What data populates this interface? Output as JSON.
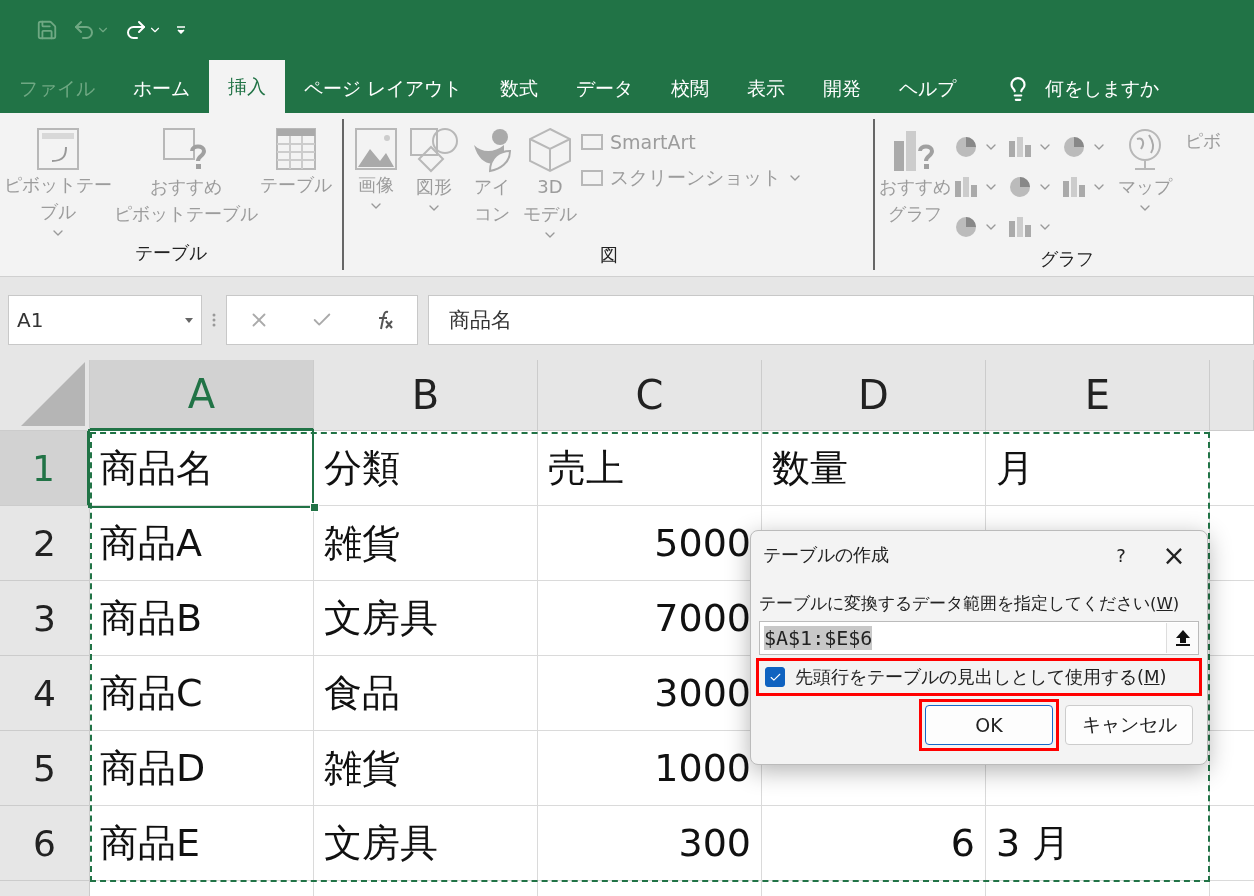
{
  "tabs": [
    {
      "label": "ファイル",
      "selected": false,
      "disabled": true
    },
    {
      "label": "ホーム",
      "selected": false,
      "disabled": false
    },
    {
      "label": "挿入",
      "selected": true,
      "disabled": false
    },
    {
      "label": "ページ レイアウト",
      "selected": false,
      "disabled": false
    },
    {
      "label": "数式",
      "selected": false,
      "disabled": false
    },
    {
      "label": "データ",
      "selected": false,
      "disabled": false
    },
    {
      "label": "校閲",
      "selected": false,
      "disabled": false
    },
    {
      "label": "表示",
      "selected": false,
      "disabled": false
    },
    {
      "label": "開発",
      "selected": false,
      "disabled": false
    },
    {
      "label": "ヘルプ",
      "selected": false,
      "disabled": false
    }
  ],
  "tell_me": "何をしますか",
  "ribbon": {
    "groups": [
      {
        "label": "テーブル",
        "items": [
          {
            "kind": "large",
            "lines": [
              "ピボットテー",
              "ブル"
            ],
            "dropdown": true
          },
          {
            "kind": "large",
            "lines": [
              "おすすめ",
              "ピボットテーブル"
            ],
            "dropdown": false
          },
          {
            "kind": "large",
            "lines": [
              "テーブル"
            ],
            "dropdown": false
          }
        ]
      },
      {
        "label": "図",
        "items": [
          {
            "kind": "large",
            "lines": [
              "画像"
            ],
            "dropdown": true
          },
          {
            "kind": "large",
            "lines": [
              "図形"
            ],
            "dropdown": true
          },
          {
            "kind": "large",
            "lines": [
              "アイ",
              "コン"
            ],
            "dropdown": false
          },
          {
            "kind": "large",
            "lines": [
              "3D",
              "モデル"
            ],
            "dropdown": true
          },
          {
            "kind": "small",
            "lines": [
              "SmartArt"
            ],
            "dropdown": false
          },
          {
            "kind": "small",
            "lines": [
              "スクリーンショット"
            ],
            "dropdown": true
          }
        ]
      },
      {
        "label": "グラフ",
        "items": [
          {
            "kind": "large",
            "lines": [
              "おすすめ",
              "グラフ"
            ],
            "dropdown": false
          },
          {
            "kind": "gallery",
            "dropdown": true
          },
          {
            "kind": "large",
            "lines": [
              "マップ"
            ],
            "dropdown": true
          },
          {
            "kind": "large",
            "lines": [
              "ピボ"
            ],
            "dropdown": false
          }
        ]
      }
    ]
  },
  "formula_bar": {
    "name_box": "A1",
    "formula": "商品名"
  },
  "grid": {
    "columns": [
      {
        "label": "A",
        "selected": true
      },
      {
        "label": "B",
        "selected": false
      },
      {
        "label": "C",
        "selected": false
      },
      {
        "label": "D",
        "selected": false
      },
      {
        "label": "E",
        "selected": false
      }
    ],
    "rows": [
      {
        "label": "1",
        "selected": true,
        "cells": [
          {
            "text": "商品名",
            "kind": "text"
          },
          {
            "text": "分類",
            "kind": "text"
          },
          {
            "text": "売上",
            "kind": "text"
          },
          {
            "text": "数量",
            "kind": "text"
          },
          {
            "text": "月",
            "kind": "text"
          }
        ]
      },
      {
        "label": "2",
        "selected": false,
        "cells": [
          {
            "text": "商品A",
            "kind": "text"
          },
          {
            "text": "雑貨",
            "kind": "text"
          },
          {
            "text": "5000",
            "kind": "number"
          },
          null,
          null
        ]
      },
      {
        "label": "3",
        "selected": false,
        "cells": [
          {
            "text": "商品B",
            "kind": "text"
          },
          {
            "text": "文房具",
            "kind": "text"
          },
          {
            "text": "7000",
            "kind": "number"
          },
          null,
          null
        ]
      },
      {
        "label": "4",
        "selected": false,
        "cells": [
          {
            "text": "商品C",
            "kind": "text"
          },
          {
            "text": "食品",
            "kind": "text"
          },
          {
            "text": "3000",
            "kind": "number"
          },
          null,
          null
        ]
      },
      {
        "label": "5",
        "selected": false,
        "cells": [
          {
            "text": "商品D",
            "kind": "text"
          },
          {
            "text": "雑貨",
            "kind": "text"
          },
          {
            "text": "1000",
            "kind": "number"
          },
          null,
          null
        ]
      },
      {
        "label": "6",
        "selected": false,
        "cells": [
          {
            "text": "商品E",
            "kind": "text"
          },
          {
            "text": "文房具",
            "kind": "text"
          },
          {
            "text": "300",
            "kind": "number"
          },
          {
            "text": "6",
            "kind": "number"
          },
          {
            "text": "3 月",
            "kind": "text"
          }
        ]
      }
    ]
  },
  "dialog": {
    "title": "テーブルの作成",
    "help": "?",
    "close": "×",
    "prompt": {
      "before": "テーブルに変換するデータ範囲を指定してください(",
      "access_key": "W",
      "after": ")"
    },
    "range": "$A$1:$E$6",
    "header_checkbox": {
      "before": "先頭行をテーブルの見出しとして使用する(",
      "access_key": "M",
      "after": ")",
      "checked": true,
      "highlighted": true
    },
    "buttons": [
      {
        "label": "OK",
        "default": true,
        "highlighted": true
      },
      {
        "label": "キャンセル",
        "default": false,
        "highlighted": false
      }
    ]
  }
}
